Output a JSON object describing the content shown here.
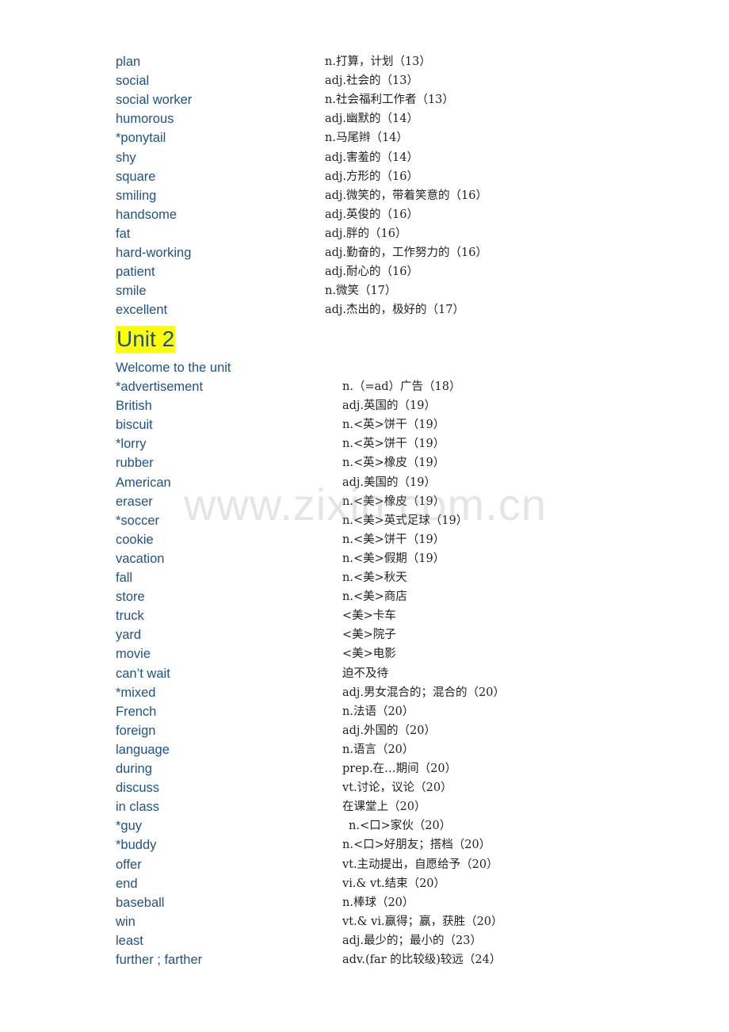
{
  "colors": {
    "english_text": "#1f5286",
    "chinese_text": "#222222",
    "heading_highlight": "#ffff00",
    "watermark": "#a0a0a0"
  },
  "watermark": "www.zixin.com.cn",
  "unit1_tail": [
    {
      "en": "plan",
      "zh": "n.打算，计划（13）"
    },
    {
      "en": "social",
      "zh": "adj.社会的（13）"
    },
    {
      "en": "social worker",
      "zh": "n.社会福利工作者（13）"
    },
    {
      "en": "humorous",
      "zh": "adj.幽默的（14）"
    },
    {
      "en": "*ponytail",
      "zh": "n.马尾辫（14）"
    },
    {
      "en": "shy",
      "zh": "adj.害羞的（14）"
    },
    {
      "en": "square",
      "zh": "adj.方形的（16）"
    },
    {
      "en": "smiling",
      "zh": "adj.微笑的，带着笑意的（16）"
    },
    {
      "en": "handsome",
      "zh": "adj.英俊的（16）"
    },
    {
      "en": "fat",
      "zh": "adj.胖的（16）"
    },
    {
      "en": "hard-working",
      "zh": "adj.勤奋的，工作努力的（16）"
    },
    {
      "en": "patient",
      "zh": "adj.耐心的（16）"
    },
    {
      "en": "smile",
      "zh": "n.微笑（17）"
    },
    {
      "en": "excellent",
      "zh": "adj.杰出的，极好的（17）"
    }
  ],
  "unit2": {
    "heading": "Unit 2",
    "subheading": "Welcome to the unit",
    "items": [
      {
        "en": "*advertisement",
        "zh": "n.（=ad）广告（18）"
      },
      {
        "en": "British",
        "zh": "adj.英国的（19）"
      },
      {
        "en": "biscuit",
        "zh": "n.<英>饼干（19）"
      },
      {
        "en": "*lorry",
        "zh": "n.<英>饼干（19）"
      },
      {
        "en": "rubber",
        "zh": "n.<英>橡皮（19）"
      },
      {
        "en": "American",
        "zh": "adj.美国的（19）"
      },
      {
        "en": "eraser",
        "zh": "n.<美>橡皮（19）"
      },
      {
        "en": "*soccer",
        "zh": "n.<美>英式足球（19）"
      },
      {
        "en": "cookie",
        "zh": "n.<美>饼干（19）"
      },
      {
        "en": "vacation",
        "zh": "n.<美>假期（19）"
      },
      {
        "en": "fall",
        "zh": "n.<美>秋天"
      },
      {
        "en": "store",
        "zh": "n.<美>商店"
      },
      {
        "en": "truck",
        "zh": "<美>卡车"
      },
      {
        "en": "yard",
        "zh": "<美>院子"
      },
      {
        "en": "movie",
        "zh": "<美>电影"
      },
      {
        "en": "can’t wait",
        "zh": "迫不及待"
      },
      {
        "en": "*mixed",
        "zh": "adj.男女混合的；混合的（20）"
      },
      {
        "en": "French",
        "zh": "n.法语（20）"
      },
      {
        "en": "foreign",
        "zh": "adj.外国的（20）"
      },
      {
        "en": "language",
        "zh": "n.语言（20）"
      },
      {
        "en": "during",
        "zh": "prep.在…期间（20）"
      },
      {
        "en": "discuss",
        "zh": "vt.讨论，议论（20）"
      },
      {
        "en": "in class",
        "zh": "在课堂上（20）"
      },
      {
        "en": "*guy",
        "zh": "n.<口>家伙（20）"
      },
      {
        "en": "*buddy",
        "zh": "n.<口>好朋友；搭档（20）"
      },
      {
        "en": "offer",
        "zh": "vt.主动提出，自愿给予（20）"
      },
      {
        "en": "end",
        "zh": "vi.& vt.结束（20）"
      },
      {
        "en": "baseball",
        "zh": "n.棒球（20）"
      },
      {
        "en": "win",
        "zh": "vt.& vi.赢得；赢，获胜（20）"
      },
      {
        "en": "least",
        "zh": "adj.最少的；最小的（23）"
      },
      {
        "en": "further ; farther",
        "zh": "adv.(far 的比较级)较远（24）"
      }
    ]
  }
}
